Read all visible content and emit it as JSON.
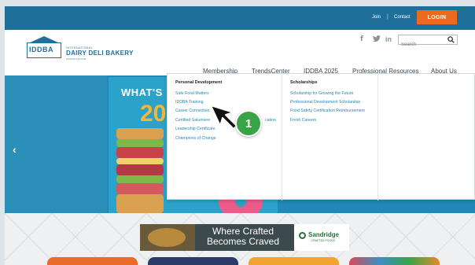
{
  "topbar": {
    "join": "Join",
    "contact": "Contact",
    "separator": "|",
    "login": "LOGIN",
    "color": "#1f6f9b",
    "login_color": "#ea6a1f"
  },
  "logo": {
    "abbr": "IDDBA",
    "small_top": "INTERNATIONAL",
    "main": "DAIRY DELI BAKERY",
    "small_bottom": "ASSOCIATION"
  },
  "social": {
    "facebook": "f",
    "twitter": "🐦",
    "linkedin": "in"
  },
  "search": {
    "placeholder": "Search"
  },
  "nav": {
    "items": [
      "Membership",
      "TrendsCenter",
      "IDDBA 2025",
      "Professional Resources",
      "About Us"
    ]
  },
  "hero": {
    "poster_title": "WHAT'S",
    "poster_number": "20",
    "prev_arrow": "‹"
  },
  "dropdown": {
    "col1": {
      "heading": "Personal Development",
      "items": [
        "Safe Food Matters",
        "IDDBA Training",
        "Career Connection",
        "Certified Salumiere",
        "Leadership Certificate",
        "Champions of Change"
      ]
    },
    "col2": {
      "heading": "Scholarships",
      "items": [
        "Scholarship for Growing the Future",
        "Professional Development Scholarship",
        "Food Safety Certification Reimbursement",
        "Fresh Careers"
      ]
    },
    "partial_text": "cation"
  },
  "callout": {
    "badge": "1",
    "badge_color": "#3aa346"
  },
  "ad": {
    "headline_line1": "Where Crafted",
    "headline_line2": "Becomes Craved",
    "brand": "Sandridge",
    "brand_sub": "CRAFTED FOODS"
  }
}
